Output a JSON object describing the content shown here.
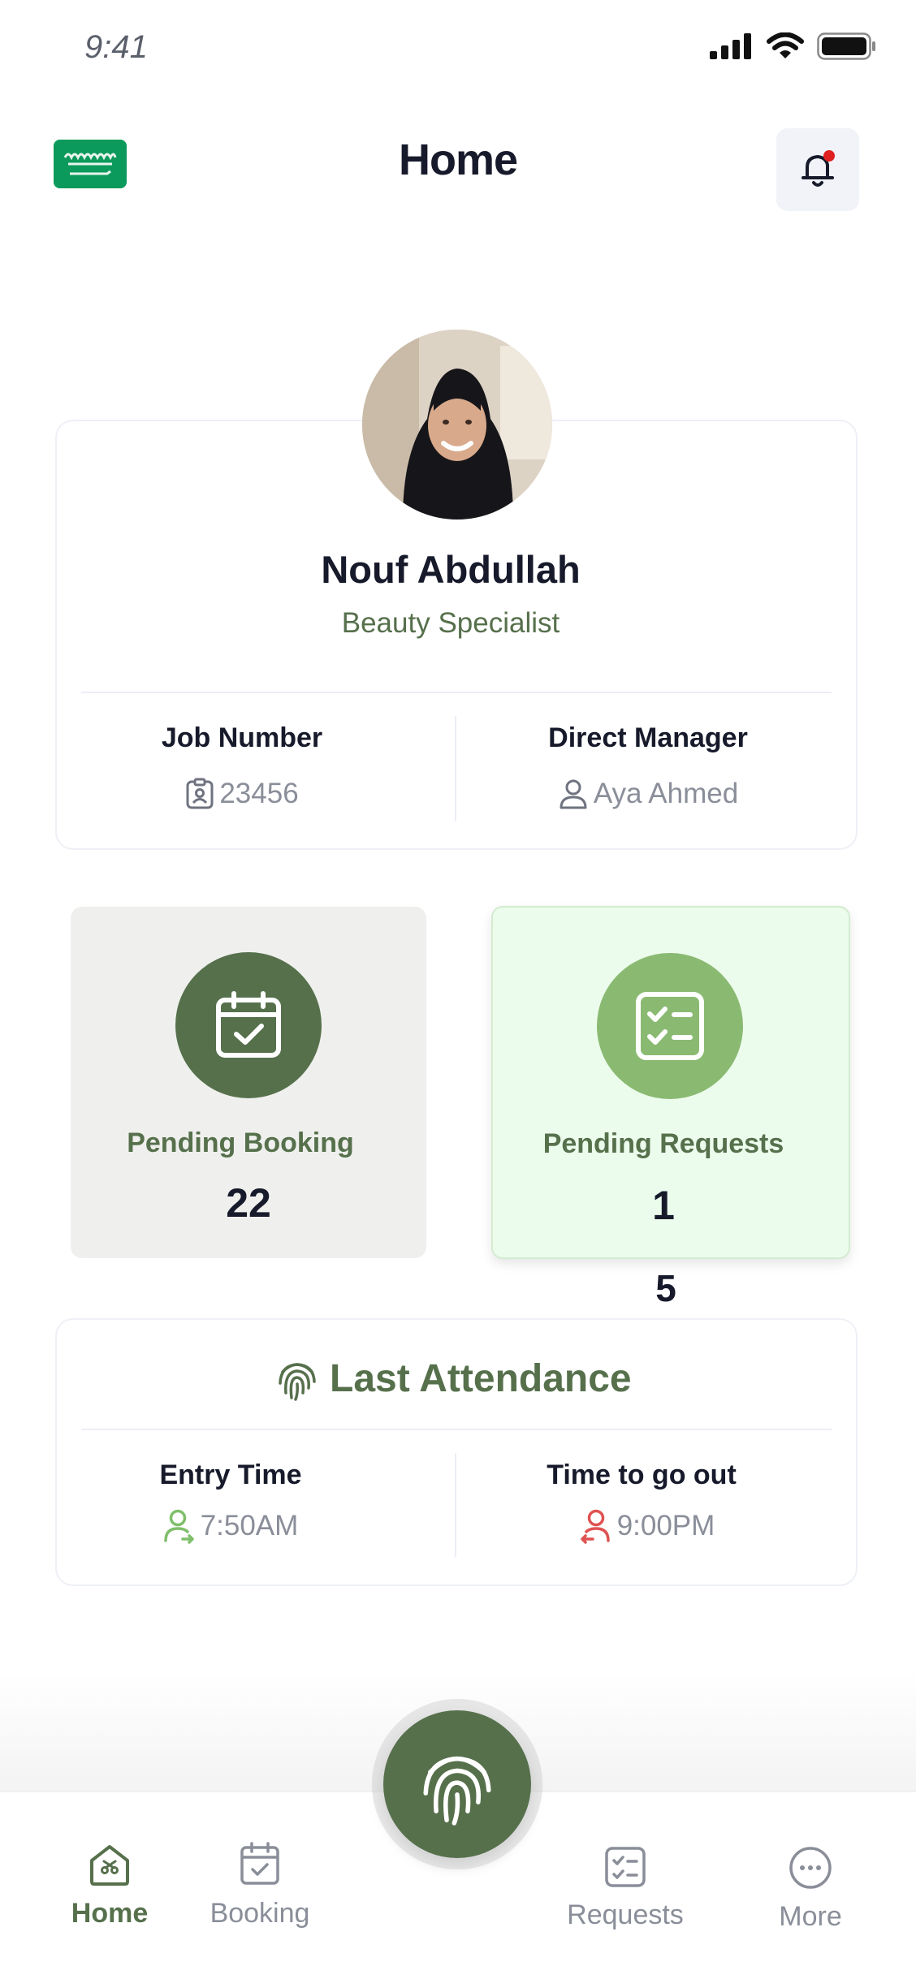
{
  "status_bar": {
    "time": "9:41"
  },
  "header": {
    "title": "Home"
  },
  "profile": {
    "name": "Nouf Abdullah",
    "role": "Beauty Specialist",
    "job_number_label": "Job Number",
    "job_number": "23456",
    "manager_label": "Direct Manager",
    "manager": "Aya Ahmed"
  },
  "stats": {
    "booking_label": "Pending Booking",
    "booking_value": "22",
    "requests_label": "Pending Requests",
    "requests_value": "1",
    "overflow_value": "5"
  },
  "attendance": {
    "title": "Last Attendance",
    "entry_label": "Entry Time",
    "entry_time": "7:50AM",
    "exit_label": "Time to go out",
    "exit_time": "9:00PM"
  },
  "nav": {
    "home": "Home",
    "booking": "Booking",
    "requests": "Requests",
    "more": "More"
  },
  "colors": {
    "primary": "#56704c",
    "primary_light": "#8aba72",
    "requests_bg": "#ecfcec",
    "booking_bg": "#eff0ed",
    "alert": "#e02020",
    "exit_icon": "#e05252",
    "entry_icon": "#7fbf6a"
  }
}
